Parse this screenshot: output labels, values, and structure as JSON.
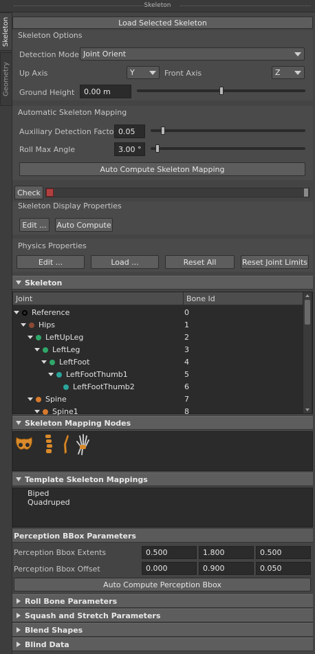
{
  "window": {
    "title": "Skeleton"
  },
  "side_tabs": [
    {
      "label": "Skeleton",
      "active": true
    },
    {
      "label": "Geometry",
      "active": false
    }
  ],
  "load_button": "Load Selected Skeleton",
  "skeleton_options": {
    "title": "Skeleton Options",
    "detection_mode_label": "Detection Mode",
    "detection_mode_value": "Joint Orient",
    "up_axis_label": "Up Axis",
    "up_axis_value": "Y",
    "front_axis_label": "Front Axis",
    "front_axis_value": "Z",
    "ground_height_label": "Ground Height",
    "ground_height_value": "0.00 m",
    "ground_height_slider": 0.5
  },
  "auto_mapping": {
    "title": "Automatic Skeleton Mapping",
    "aux_label": "Auxiliary Detection Factor",
    "aux_value": "0.05",
    "aux_slider": 0.02,
    "roll_label": "Roll Max Angle",
    "roll_value": "3.00 °",
    "roll_slider": 0.0,
    "compute_button": "Auto Compute Skeleton Mapping"
  },
  "check_button": "Check",
  "display_props": {
    "title": "Skeleton Display Properties",
    "edit_button": "Edit ...",
    "auto_compute_button": "Auto Compute"
  },
  "physics": {
    "title": "Physics Properties",
    "edit_button": "Edit ...",
    "load_button": "Load ...",
    "reset_all_button": "Reset All",
    "reset_limits_button": "Reset Joint Limits"
  },
  "skeleton_frame": {
    "title": "Skeleton",
    "col_joint": "Joint",
    "col_bone_id": "Bone Id",
    "rows": [
      {
        "name": "Reference",
        "id": "0",
        "depth": 0,
        "color": "#000000",
        "expand": true
      },
      {
        "name": "Hips",
        "id": "1",
        "depth": 1,
        "color": "#8a4a35",
        "expand": true
      },
      {
        "name": "LeftUpLeg",
        "id": "2",
        "depth": 2,
        "color": "#2fa86a",
        "expand": true
      },
      {
        "name": "LeftLeg",
        "id": "3",
        "depth": 3,
        "color": "#2fa86a",
        "expand": true
      },
      {
        "name": "LeftFoot",
        "id": "4",
        "depth": 4,
        "color": "#2fa86a",
        "expand": true
      },
      {
        "name": "LeftFootThumb1",
        "id": "5",
        "depth": 5,
        "color": "#2aa59c",
        "expand": true
      },
      {
        "name": "LeftFootThumb2",
        "id": "6",
        "depth": 6,
        "color": "#2aa59c",
        "expand": false
      },
      {
        "name": "Spine",
        "id": "7",
        "depth": 2,
        "color": "#d77a2c",
        "expand": true
      },
      {
        "name": "Spine1",
        "id": "8",
        "depth": 3,
        "color": "#d77a2c",
        "expand": true
      }
    ]
  },
  "mapping_nodes": {
    "title": "Skeleton Mapping Nodes",
    "icons": [
      "pelvis-bone-icon",
      "spine-bone-icon",
      "leg-bone-icon",
      "hand-bone-icon"
    ]
  },
  "template_mappings": {
    "title": "Template Skeleton Mappings",
    "items": [
      "Biped",
      "Quadruped"
    ]
  },
  "perception": {
    "title": "Perception BBox Parameters",
    "extents_label": "Perception Bbox Extents",
    "extents": [
      "0.500",
      "1.800",
      "0.500"
    ],
    "offset_label": "Perception Bbox Offset",
    "offset": [
      "0.000",
      "0.900",
      "0.050"
    ],
    "compute_button": "Auto Compute Perception Bbox"
  },
  "collapsed_frames": [
    "Roll Bone Parameters",
    "Squash and Stretch Parameters",
    "Blend Shapes",
    "Blind Data"
  ]
}
